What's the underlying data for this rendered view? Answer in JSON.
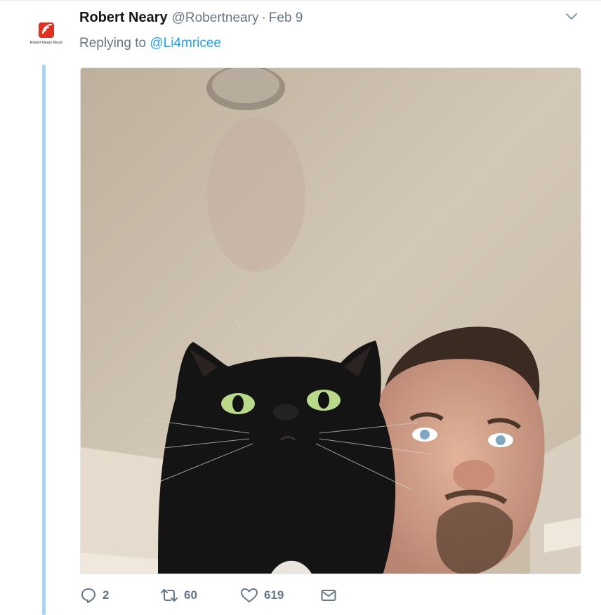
{
  "tweet": {
    "author_name": "Robert Neary",
    "author_handle": "@Robertneary",
    "separator": "·",
    "date": "Feb 9",
    "replying_prefix": "Replying to",
    "replying_to": "@Li4mricee",
    "avatar_text": "Robert Neary Music",
    "avatar_color": "#e0301e",
    "accent_color": "#1da1f2",
    "thread_line_color": "#a6d5f7",
    "icons": {
      "menu": "chevron-down-icon",
      "reply": "reply-icon",
      "retweet": "retweet-icon",
      "like": "heart-icon",
      "dm": "envelope-icon"
    }
  },
  "actions": {
    "replies": "2",
    "retweets": "60",
    "likes": "619"
  }
}
